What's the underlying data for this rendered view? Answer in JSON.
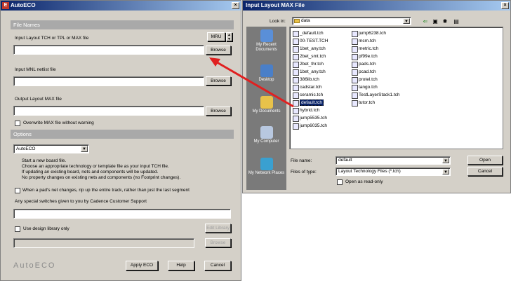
{
  "left_window": {
    "title": "AutoECO",
    "close_glyph": "×",
    "section_files": "File Names",
    "tch_label": "Input Layout TCH or TPL or MAX file",
    "mru_label": "MRU",
    "browse_label": "Browse",
    "mnl_label": "Input MNL netlist file",
    "output_label": "Output Layout MAX file",
    "overwrite_label": "Overwrite MAX file without warning",
    "section_options": "Options",
    "mode_value": "AutoECO",
    "help_lines": [
      "Start a new board file.",
      "Choose an appropriate technology or template file as your input TCH file.",
      "If updating an existing board, nets and components will be updated.",
      "No property changes on existing nets and components (no Footprint changes)."
    ],
    "pad_net_label": "When a pad's net changes, rip up the entire track, rather than just the last segment",
    "switches_label": "Any special switches given to you by Cadence Customer Support",
    "design_lib_label": "Use design library only",
    "edit_library_label": "Edit Library",
    "footer_logo": "AutoECO",
    "apply_label": "Apply ECO",
    "help_label": "Help",
    "cancel_label": "Cancel"
  },
  "right_window": {
    "title": "Input Layout MAX File",
    "close_glyph": "×",
    "look_in_label": "Look in:",
    "look_in_value": "data",
    "places": [
      "My Recent Documents",
      "Desktop",
      "My Documents",
      "My Computer",
      "My Network Places"
    ],
    "files_col1": [
      "_default.tch",
      "00-TEST.TCH",
      "1bet_any.tch",
      "2bet_smt.tch",
      "2bet_thr.tch",
      "1bet_any.tch",
      "386lib.tch",
      "cadstar.tch",
      "ceramic.tch",
      "default.tch",
      "hybrid.tch",
      "jump5535.tch",
      "jump6035.tch"
    ],
    "files_col2": [
      "jump6238.tch",
      "mcm.tch",
      "metric.tch",
      "pf99e.tch",
      "pads.tch",
      "pcad.tch",
      "protel.tch",
      "tango.tch",
      "TestLayerStack1.tch",
      "tutor.tch"
    ],
    "selected_file": "default.tch",
    "file_name_label": "File name:",
    "file_name_value": "default",
    "file_type_label": "Files of type:",
    "file_type_value": "Layout Technology Files (*.tch)",
    "read_only_label": "Open as read-only",
    "open_label": "Open",
    "cancel_label": "Cancel"
  },
  "colors": {
    "arrow": "#e02020",
    "titlebar": "#0a246a",
    "section": "#a9a9a9"
  }
}
